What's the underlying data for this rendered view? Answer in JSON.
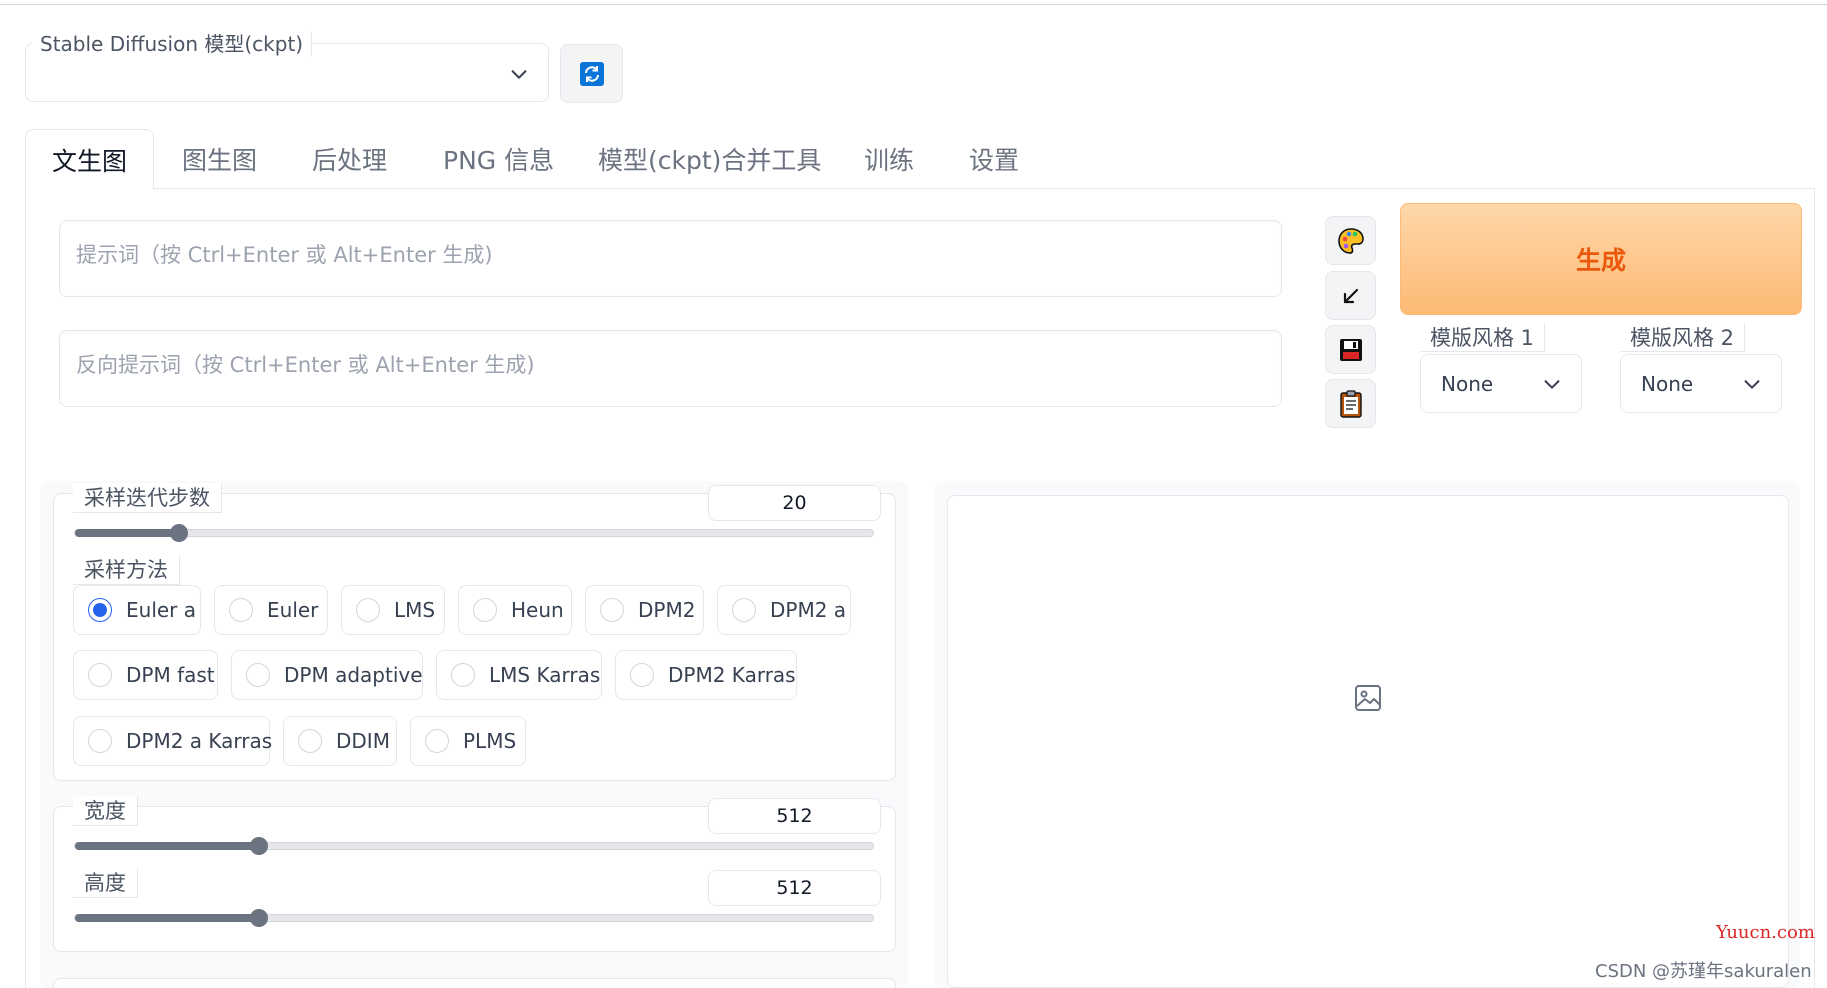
{
  "model_selector": {
    "label": "Stable Diffusion 模型(ckpt)",
    "value": ""
  },
  "tabs": [
    {
      "label": "文生图",
      "active": true
    },
    {
      "label": "图生图",
      "active": false
    },
    {
      "label": "后处理",
      "active": false
    },
    {
      "label": "PNG 信息",
      "active": false
    },
    {
      "label": "模型(ckpt)合并工具",
      "active": false
    },
    {
      "label": "训练",
      "active": false
    },
    {
      "label": "设置",
      "active": false
    }
  ],
  "prompt": {
    "placeholder": "提示词（按 Ctrl+Enter 或 Alt+Enter 生成)"
  },
  "negative_prompt": {
    "placeholder": "反向提示词（按 Ctrl+Enter 或 Alt+Enter 生成)"
  },
  "tool_buttons": [
    "palette-icon",
    "arrow-down-left-icon",
    "save-icon",
    "clipboard-icon"
  ],
  "generate": {
    "label": "生成",
    "color": "#ea580c",
    "bg": "#fdba74"
  },
  "styles": [
    {
      "label": "模版风格 1",
      "value": "None"
    },
    {
      "label": "模版风格 2",
      "value": "None"
    }
  ],
  "sampling_steps": {
    "label": "采样迭代步数",
    "value": "20",
    "min": 1,
    "max": 150,
    "fraction": 0.13
  },
  "sampling_method": {
    "label": "采样方法",
    "selected": "Euler a",
    "options": [
      "Euler a",
      "Euler",
      "LMS",
      "Heun",
      "DPM2",
      "DPM2 a",
      "DPM fast",
      "DPM adaptive",
      "LMS Karras",
      "DPM2 Karras",
      "DPM2 a Karras",
      "DDIM",
      "PLMS"
    ]
  },
  "width": {
    "label": "宽度",
    "value": "512",
    "fraction": 0.23
  },
  "height": {
    "label": "高度",
    "value": "512",
    "fraction": 0.23
  },
  "output": {
    "placeholder_icon": "image-icon"
  },
  "watermarks": {
    "yuucn": "Yuucn.com",
    "csdn": "CSDN @苏瑾年sakuralen"
  },
  "colors": {
    "accent": "#2563eb",
    "slider": "#6b7280",
    "border": "#e5e7eb"
  }
}
